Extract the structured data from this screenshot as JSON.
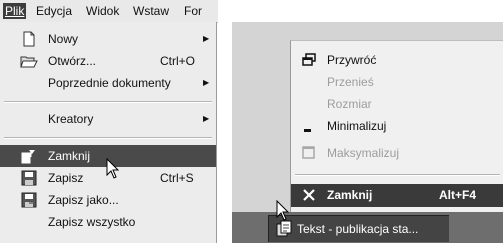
{
  "menubar": {
    "items": [
      {
        "label": "Plik",
        "active": true
      },
      {
        "label": "Edycja"
      },
      {
        "label": "Widok"
      },
      {
        "label": "Wstaw"
      },
      {
        "label": "For"
      }
    ]
  },
  "file_menu": {
    "items": [
      {
        "label": "Nowy",
        "icon": "new-document-icon",
        "submenu": true
      },
      {
        "label": "Otwórz...",
        "shortcut": "Ctrl+O",
        "icon": "open-folder-icon"
      },
      {
        "label": "Poprzednie dokumenty",
        "submenu": true
      },
      {
        "label": "Kreatory",
        "submenu": true
      },
      {
        "label": "Zamknij",
        "icon": "close-document-icon",
        "highlighted": true
      },
      {
        "label": "Zapisz",
        "shortcut": "Ctrl+S",
        "icon": "floppy-disk-icon"
      },
      {
        "label": "Zapisz jako...",
        "icon": "floppy-disk-as-icon"
      },
      {
        "label": "Zapisz wszystko"
      }
    ]
  },
  "system_menu": {
    "items": [
      {
        "label": "Przywróć",
        "icon": "restore-window-icon",
        "disabled": false
      },
      {
        "label": "Przenieś",
        "disabled": true
      },
      {
        "label": "Rozmiar",
        "disabled": true
      },
      {
        "label": "Minimalizuj",
        "icon": "minimize-icon",
        "disabled": false
      },
      {
        "label": "Maksymalizuj",
        "icon": "maximize-icon",
        "disabled": true
      },
      {
        "label": "Zamknij",
        "shortcut": "Alt+F4",
        "icon": "close-x-icon",
        "highlighted": true
      }
    ]
  },
  "taskbar": {
    "button_label": "Tekst - publikacja sta..."
  }
}
